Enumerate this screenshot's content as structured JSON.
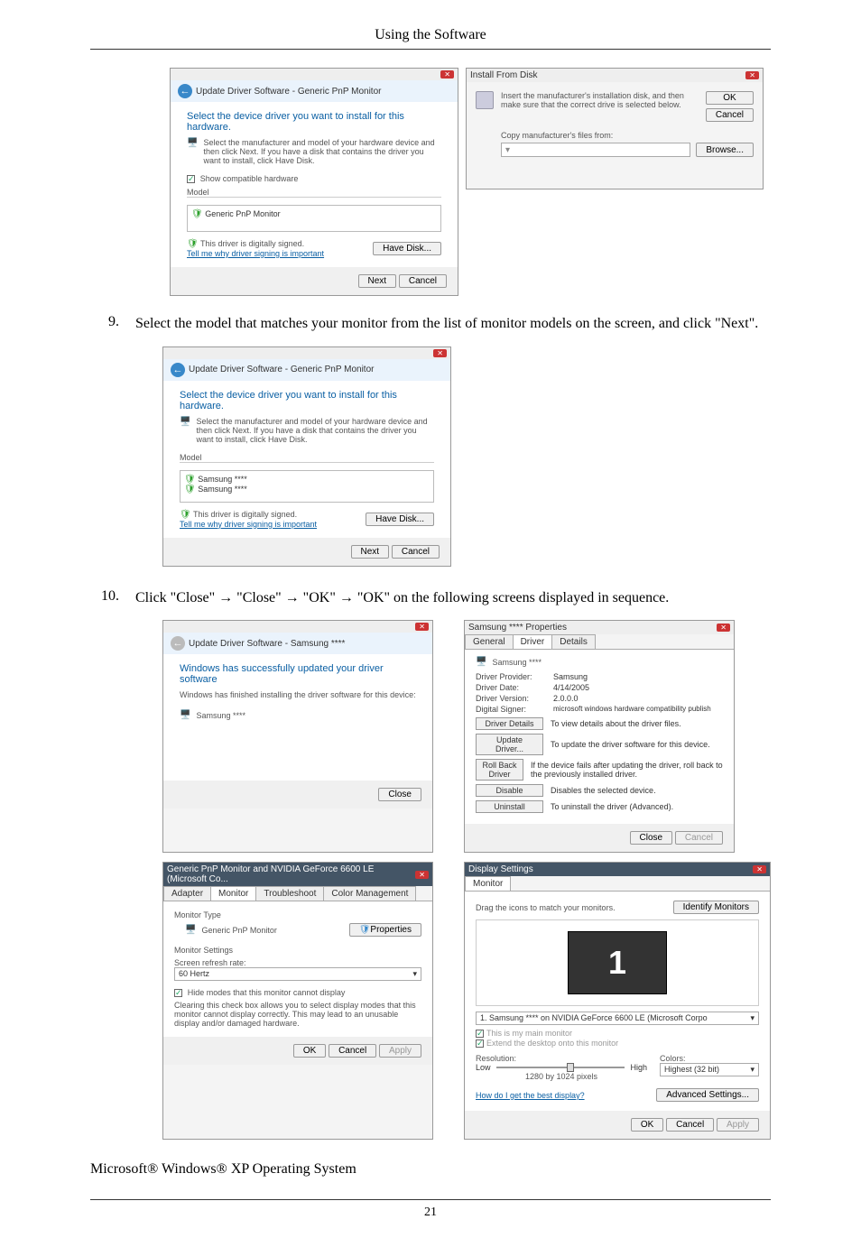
{
  "header": {
    "title": "Using the Software"
  },
  "figA": {
    "crumb": "Update Driver Software - Generic PnP Monitor",
    "heading": "Select the device driver you want to install for this hardware.",
    "body_text": "Select the manufacturer and model of your hardware device and then click Next. If you have a disk that contains the driver you want to install, click Have Disk.",
    "show_compat": "Show compatible hardware",
    "model_label": "Model",
    "model_item": "Generic PnP Monitor",
    "signed": "This driver is digitally signed.",
    "signing_link": "Tell me why driver signing is important",
    "have_disk": "Have Disk...",
    "next": "Next",
    "cancel": "Cancel"
  },
  "figB": {
    "title": "Install From Disk",
    "body_text": "Insert the manufacturer's installation disk, and then make sure that the correct drive is selected below.",
    "ok": "OK",
    "cancel": "Cancel",
    "copy_label": "Copy manufacturer's files from:",
    "browse": "Browse..."
  },
  "step9": {
    "num": "9.",
    "text": "Select the model that matches your monitor from the list of monitor models on the screen, and click \"Next\"."
  },
  "figC": {
    "crumb": "Update Driver Software - Generic PnP Monitor",
    "heading": "Select the device driver you want to install for this hardware.",
    "body_text": "Select the manufacturer and model of your hardware device and then click Next. If you have a disk that contains the driver you want to install, click Have Disk.",
    "model_label": "Model",
    "item1": "Samsung ****",
    "item2": "Samsung ****",
    "signed": "This driver is digitally signed.",
    "signing_link": "Tell me why driver signing is important",
    "have_disk": "Have Disk...",
    "next": "Next",
    "cancel": "Cancel"
  },
  "step10": {
    "num": "10.",
    "text": "Click \"Close\" → \"Close\" → \"OK\" → \"OK\" on the following screens displayed in sequence."
  },
  "figD": {
    "crumb": "Update Driver Software - Samsung ****",
    "heading": "Windows has successfully updated your driver software",
    "body_text": "Windows has finished installing the driver software for this device:",
    "device": "Samsung ****",
    "close": "Close"
  },
  "figE": {
    "title": "Samsung **** Properties",
    "tab_general": "General",
    "tab_driver": "Driver",
    "tab_details": "Details",
    "device": "Samsung ****",
    "provider_lbl": "Driver Provider:",
    "provider_val": "Samsung",
    "date_lbl": "Driver Date:",
    "date_val": "4/14/2005",
    "version_lbl": "Driver Version:",
    "version_val": "2.0.0.0",
    "signer_lbl": "Digital Signer:",
    "signer_val": "microsoft windows hardware compatibility publish",
    "btn_details": "Driver Details",
    "btn_details_desc": "To view details about the driver files.",
    "btn_update": "Update Driver...",
    "btn_update_desc": "To update the driver software for this device.",
    "btn_rollback": "Roll Back Driver",
    "btn_rollback_desc": "If the device fails after updating the driver, roll back to the previously installed driver.",
    "btn_disable": "Disable",
    "btn_disable_desc": "Disables the selected device.",
    "btn_uninstall": "Uninstall",
    "btn_uninstall_desc": "To uninstall the driver (Advanced).",
    "close": "Close",
    "cancel": "Cancel"
  },
  "figF": {
    "title": "Generic PnP Monitor and NVIDIA GeForce 6600 LE (Microsoft Co...",
    "tab_adapter": "Adapter",
    "tab_monitor": "Monitor",
    "tab_trouble": "Troubleshoot",
    "tab_color": "Color Management",
    "monitor_type": "Monitor Type",
    "monitor_name": "Generic PnP Monitor",
    "properties": "Properties",
    "monitor_settings": "Monitor Settings",
    "refresh_label": "Screen refresh rate:",
    "refresh_value": "60 Hertz",
    "hide_modes": "Hide modes that this monitor cannot display",
    "hide_modes_desc": "Clearing this check box allows you to select display modes that this monitor cannot display correctly. This may lead to an unusable display and/or damaged hardware.",
    "ok": "OK",
    "cancel": "Cancel",
    "apply": "Apply"
  },
  "figG": {
    "title": "Display Settings",
    "tab_monitor": "Monitor",
    "drag_text": "Drag the icons to match your monitors.",
    "identify": "Identify Monitors",
    "preview_num": "1",
    "selector": "1. Samsung **** on NVIDIA GeForce 6600 LE (Microsoft Corpo",
    "main_monitor": "This is my main monitor",
    "extend": "Extend the desktop onto this monitor",
    "resolution_lbl": "Resolution:",
    "low": "Low",
    "high": "High",
    "res_value": "1280 by 1024 pixels",
    "colors_lbl": "Colors:",
    "colors_value": "Highest (32 bit)",
    "best_display": "How do I get the best display?",
    "advanced": "Advanced Settings...",
    "ok": "OK",
    "cancel": "Cancel",
    "apply": "Apply"
  },
  "bottom_text": "Microsoft® Windows® XP Operating System",
  "page_number": "21"
}
